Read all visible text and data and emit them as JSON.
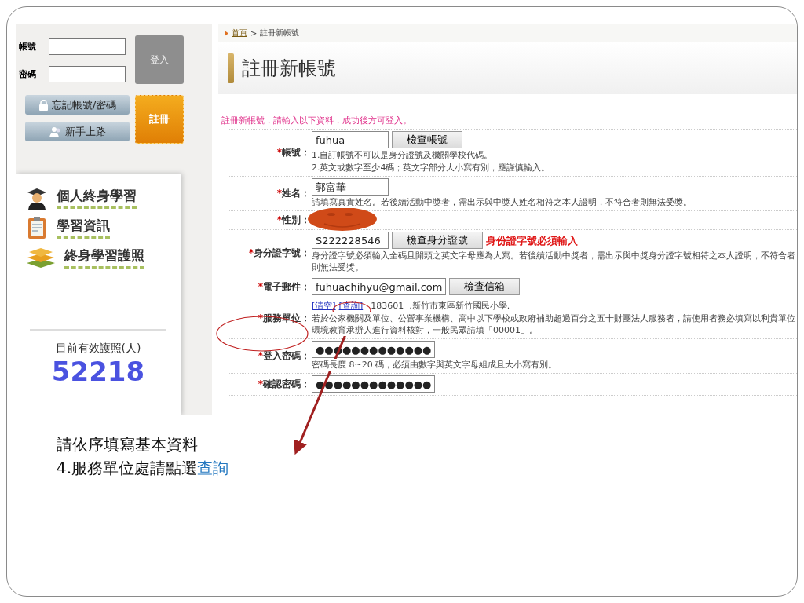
{
  "login": {
    "fields": [
      {
        "label": "帳號"
      },
      {
        "label": "密碼"
      }
    ],
    "login_button": "登入",
    "forgot_button": "忘記帳號/密碼",
    "guide_button": "新手上路",
    "register_button": "註冊"
  },
  "menu": [
    {
      "kind": "graduate",
      "label": "個人終身學習"
    },
    {
      "kind": "clipboard",
      "label": "學習資訊"
    },
    {
      "kind": "books",
      "label": "終身學習護照"
    }
  ],
  "passport_count": {
    "label": "目前有效護照(人)",
    "value": "52218"
  },
  "breadcrumb": {
    "home": "首頁",
    "separator": ">",
    "current": "註冊新帳號"
  },
  "page_title": "註冊新帳號",
  "intro": "註冊新帳號，請輸入以下資料，成功後方可登入。",
  "form": [
    {
      "mark": "*",
      "label": "帳號：",
      "value": "fuhua",
      "button": "檢查帳號",
      "notes": [
        "1.自訂帳號不可以是身分證號及機關學校代碼。",
        "2.英文或數字至少4碼；英文字部分大小寫有別，應謹慎輸入。"
      ]
    },
    {
      "mark": "*",
      "label": "姓名：",
      "value": "郭富華",
      "notes": [
        "請填寫真實姓名。若後續活動中獎者，需出示與中獎人姓名相符之本人證明，不符合者則無法受獎。"
      ]
    },
    {
      "mark": "*",
      "label": "性別：",
      "redacted": true
    },
    {
      "mark": "*",
      "label": "身分證字號：",
      "value": "S222228546",
      "button": "檢查身分證號",
      "error": "身份證字號必須輸入",
      "notes": [
        "身分證字號必須輸入全碼且開頭之英文字母應為大寫。若後續活動中獎者，需出示與中獎身分證字號相符之本人證明，不符合者則無法受獎。"
      ]
    },
    {
      "mark": "*",
      "label": "電子郵件：",
      "value": "fuhuachihyu@gmail.com",
      "button": "檢查信箱"
    },
    {
      "mark": "*",
      "label": "服務單位：",
      "links": [
        "[清空]",
        "[查詢]"
      ],
      "selection": "183601  .新竹市東區新竹國民小學.",
      "notes": [
        "若於公家機關及單位、公營事業機構、高中以下學校或政府補助超過百分之五十財團法人服務者，請使用者務必填寫以利貴單位環境教育承辦人進行資料核對，一般民眾請填「00001」。"
      ]
    },
    {
      "mark": "*",
      "label": "登入密碼：",
      "value": "●●●●●●●●●●●●●",
      "notes": [
        "密碼長度 8~20 碼，必須由數字與英文字母組成且大小寫有別。"
      ]
    },
    {
      "mark": "*",
      "label": "確認密碼：",
      "value": "●●●●●●●●●●●●●"
    }
  ],
  "caption": {
    "line1": "請依序填寫基本資料",
    "line2": "4.服務單位處請點選",
    "highlight": "查詢"
  }
}
